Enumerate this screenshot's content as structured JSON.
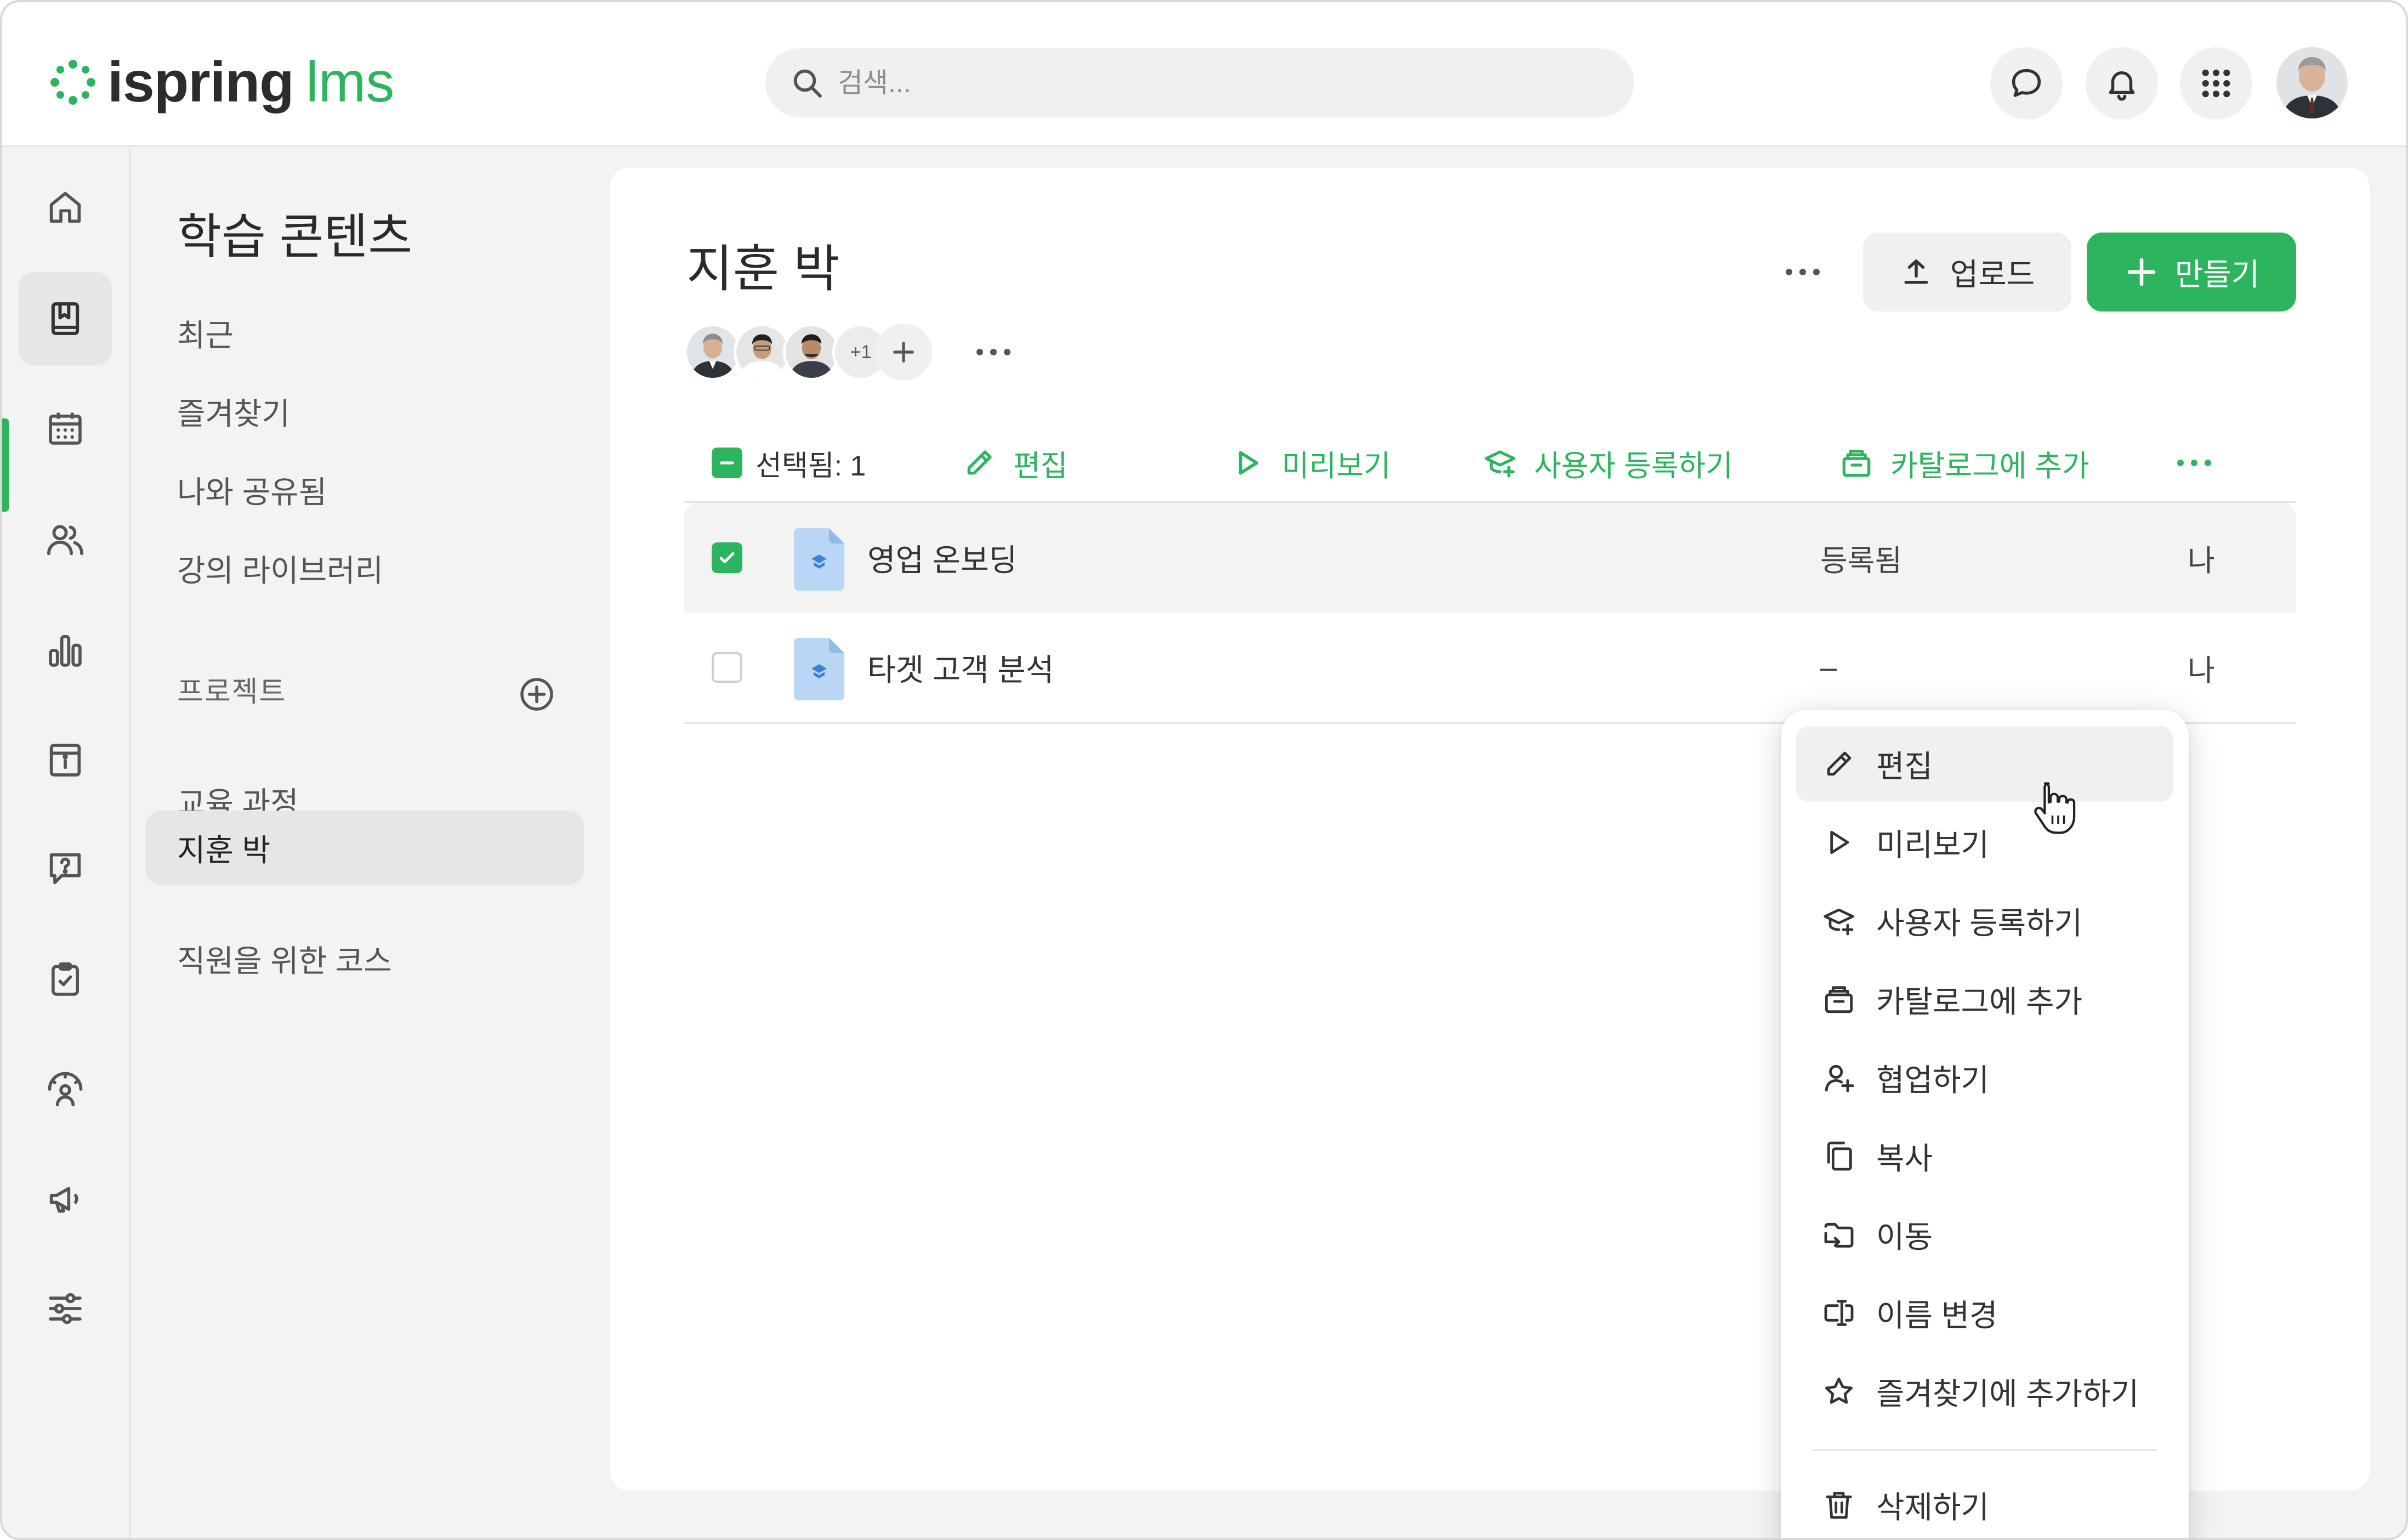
{
  "app": {
    "logo_text": "ispring",
    "logo_suffix": "lms",
    "brand_color": "#2cb45f"
  },
  "header": {
    "search": {
      "placeholder": "검색..."
    },
    "icons": [
      "chat-icon",
      "bell-icon",
      "apps-grid-icon",
      "user-avatar"
    ]
  },
  "rail": {
    "items": [
      {
        "icon": "home-icon"
      },
      {
        "icon": "book-icon",
        "active": true
      },
      {
        "icon": "calendar-icon"
      },
      {
        "icon": "users-icon"
      },
      {
        "icon": "reports-icon"
      },
      {
        "icon": "info-board-icon"
      },
      {
        "icon": "question-icon"
      },
      {
        "icon": "clipboard-check-icon"
      },
      {
        "icon": "gauge-person-icon"
      },
      {
        "icon": "megaphone-icon"
      },
      {
        "icon": "settings-sliders-icon"
      }
    ]
  },
  "nav": {
    "title": "학습 콘텐츠",
    "items": [
      {
        "label": "최근"
      },
      {
        "label": "즐겨찾기"
      },
      {
        "label": "나와 공유됨"
      },
      {
        "label": "강의 라이브러리"
      }
    ],
    "projects_label": "프로젝트",
    "projects": [
      {
        "label": "교육 과정"
      },
      {
        "label": "지훈 박",
        "active": true
      },
      {
        "label": "직원을 위한 코스"
      }
    ]
  },
  "main": {
    "title": "지훈 박",
    "collaborators_more": "+1",
    "upload_label": "업로드",
    "create_label": "만들기",
    "toolbar": {
      "selected_label": "선택됨: 1",
      "actions": [
        {
          "label": "편집"
        },
        {
          "label": "미리보기"
        },
        {
          "label": "사용자 등록하기"
        },
        {
          "label": "카탈로그에 추가"
        }
      ]
    },
    "rows": [
      {
        "name": "영업 온보딩",
        "status": "등록됨",
        "owner": "나",
        "checked": true
      },
      {
        "name": "타겟 고객 분석",
        "status": "–",
        "owner": "나",
        "checked": false
      }
    ]
  },
  "context_menu": {
    "items": [
      {
        "label": "편집",
        "icon": "pencil-icon"
      },
      {
        "label": "미리보기",
        "icon": "play-icon"
      },
      {
        "label": "사용자 등록하기",
        "icon": "graduation-add-icon"
      },
      {
        "label": "카탈로그에 추가",
        "icon": "catalog-icon"
      },
      {
        "label": "협업하기",
        "icon": "user-add-icon"
      },
      {
        "label": "복사",
        "icon": "copy-icon"
      },
      {
        "label": "이동",
        "icon": "folder-move-icon"
      },
      {
        "label": "이름 변경",
        "icon": "rename-icon"
      },
      {
        "label": "즐겨찾기에 추가하기",
        "icon": "star-icon"
      },
      {
        "label": "삭제하기",
        "icon": "trash-icon"
      }
    ]
  }
}
